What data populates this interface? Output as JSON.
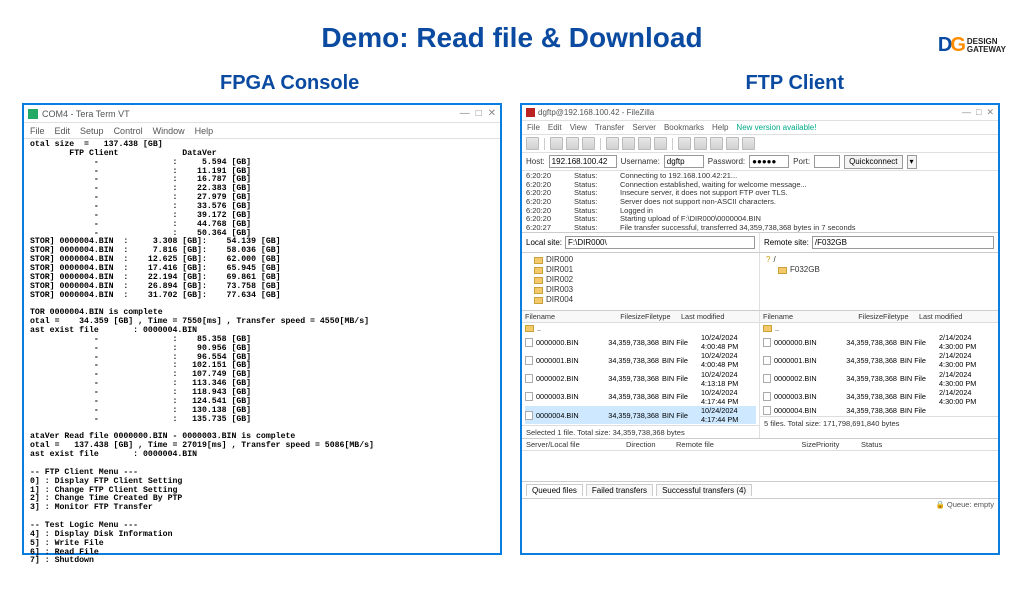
{
  "brand": {
    "initials_d": "D",
    "initials_g": "G",
    "name_l1": "DESIGN",
    "name_l2": "GATEWAY"
  },
  "title": "Demo: Read file & Download",
  "left_label": "FPGA Console",
  "right_label": "FTP Client",
  "teraterm": {
    "title": "COM4 - Tera Term VT",
    "menu": [
      "File",
      "Edit",
      "Setup",
      "Control",
      "Window",
      "Help"
    ],
    "body": "otal size  =   137.438 [GB]\n        FTP Client             DataVer\n             -               :     5.594 [GB]\n             -               :    11.191 [GB]\n             -               :    16.787 [GB]\n             -               :    22.383 [GB]\n             -               :    27.979 [GB]\n             -               :    33.576 [GB]\n             -               :    39.172 [GB]\n             -               :    44.768 [GB]\n             -               :    50.364 [GB]\nSTOR] 0000004.BIN  :     3.308 [GB]:    54.139 [GB]\nSTOR] 0000004.BIN  :     7.816 [GB]:    58.036 [GB]\nSTOR] 0000004.BIN  :    12.625 [GB]:    62.000 [GB]\nSTOR] 0000004.BIN  :    17.416 [GB]:    65.945 [GB]\nSTOR] 0000004.BIN  :    22.194 [GB]:    69.861 [GB]\nSTOR] 0000004.BIN  :    26.894 [GB]:    73.758 [GB]\nSTOR] 0000004.BIN  :    31.702 [GB]:    77.634 [GB]\n\nTOR 0000004.BIN is complete\notal =    34.359 [GB] , Time = 7550[ms] , Transfer speed = 4550[MB/s]\nast exist file       : 0000004.BIN\n             -               :    85.358 [GB]\n             -               :    90.956 [GB]\n             -               :    96.554 [GB]\n             -               :   102.151 [GB]\n             -               :   107.749 [GB]\n             -               :   113.346 [GB]\n             -               :   118.943 [GB]\n             -               :   124.541 [GB]\n             -               :   130.138 [GB]\n             -               :   135.735 [GB]\n\nataVer Read file 0000000.BIN - 0000003.BIN is complete\notal =   137.438 [GB] , Time = 27019[ms] , Transfer speed = 5086[MB/s]\nast exist file       : 0000004.BIN\n\n-- FTP Client Menu ---\n0] : Display FTP Client Setting\n1] : Change FTP Client Setting\n2] : Change Time Created By PTP\n3] : Monitor FTP Transfer\n\n-- Test Logic Menu ---\n4] : Display Disk Information\n5] : Write File\n6] : Read File\n7] : Shutdown"
  },
  "filezilla": {
    "title": "dgftp@192.168.100.42 - FileZilla",
    "menu": [
      "File",
      "Edit",
      "View",
      "Transfer",
      "Server",
      "Bookmarks",
      "Help"
    ],
    "new_version": "New version available!",
    "conn": {
      "host_label": "Host:",
      "host": "192.168.100.42",
      "user_label": "Username:",
      "user": "dgftp",
      "pass_label": "Password:",
      "pass": "●●●●●",
      "port_label": "Port:",
      "port": "",
      "quick": "Quickconnect"
    },
    "log": [
      {
        "t": "6:20:20",
        "s": "Status:",
        "m": "Connecting to 192.168.100.42:21..."
      },
      {
        "t": "6:20:20",
        "s": "Status:",
        "m": "Connection established, waiting for welcome message..."
      },
      {
        "t": "6:20:20",
        "s": "Status:",
        "m": "Insecure server, it does not support FTP over TLS."
      },
      {
        "t": "6:20:20",
        "s": "Status:",
        "m": "Server does not support non-ASCII characters."
      },
      {
        "t": "6:20:20",
        "s": "Status:",
        "m": "Logged in"
      },
      {
        "t": "6:20:20",
        "s": "Status:",
        "m": "Starting upload of F:\\DIR000\\0000004.BIN"
      },
      {
        "t": "6:20:27",
        "s": "Status:",
        "m": "File transfer successful, transferred 34,359,738,368 bytes in 7 seconds"
      }
    ],
    "local_site_label": "Local site:",
    "local_site": "F:\\DIR000\\",
    "remote_site_label": "Remote site:",
    "remote_site": "/F032GB",
    "local_tree": [
      "DIR000",
      "DIR001",
      "DIR002",
      "DIR003",
      "DIR004"
    ],
    "remote_tree_root": "/",
    "remote_tree_item": "F032GB",
    "list_headers": {
      "name": "Filename",
      "size": "Filesize",
      "type": "Filetype",
      "mod": "Last modified"
    },
    "local_files": [
      {
        "n": "0000000.BIN",
        "s": "34,359,738,368",
        "t": "BIN File",
        "m": "10/24/2024 4:00:48 PM",
        "sel": false
      },
      {
        "n": "0000001.BIN",
        "s": "34,359,738,368",
        "t": "BIN File",
        "m": "10/24/2024 4:00:48 PM",
        "sel": false
      },
      {
        "n": "0000002.BIN",
        "s": "34,359,738,368",
        "t": "BIN File",
        "m": "10/24/2024 4:13:18 PM",
        "sel": false
      },
      {
        "n": "0000003.BIN",
        "s": "34,359,738,368",
        "t": "BIN File",
        "m": "10/24/2024 4:17:44 PM",
        "sel": false
      },
      {
        "n": "0000004.BIN",
        "s": "34,359,738,368",
        "t": "BIN File",
        "m": "10/24/2024 4:17:44 PM",
        "sel": true
      }
    ],
    "remote_files": [
      {
        "n": "0000000.BIN",
        "s": "34,359,738,368",
        "t": "BIN File",
        "m": "2/14/2024 4:30:00 PM"
      },
      {
        "n": "0000001.BIN",
        "s": "34,359,738,368",
        "t": "BIN File",
        "m": "2/14/2024 4:30:00 PM"
      },
      {
        "n": "0000002.BIN",
        "s": "34,359,738,368",
        "t": "BIN File",
        "m": "2/14/2024 4:30:00 PM"
      },
      {
        "n": "0000003.BIN",
        "s": "34,359,738,368",
        "t": "BIN File",
        "m": "2/14/2024 4:30:00 PM"
      },
      {
        "n": "0000004.BIN",
        "s": "34,359,738,368",
        "t": "BIN File",
        "m": ""
      }
    ],
    "local_sel_status": "Selected 1 file. Total size: 34,359,738,368 bytes",
    "remote_status": "5 files. Total size: 171,798,691,840 bytes",
    "queue_headers": [
      "Server/Local file",
      "Direction",
      "Remote file",
      "Size",
      "Priority",
      "Status"
    ],
    "tabs": {
      "queued": "Queued files",
      "failed": "Failed transfers",
      "success": "Successful transfers (4)"
    },
    "queue_empty": "Queue: empty"
  }
}
